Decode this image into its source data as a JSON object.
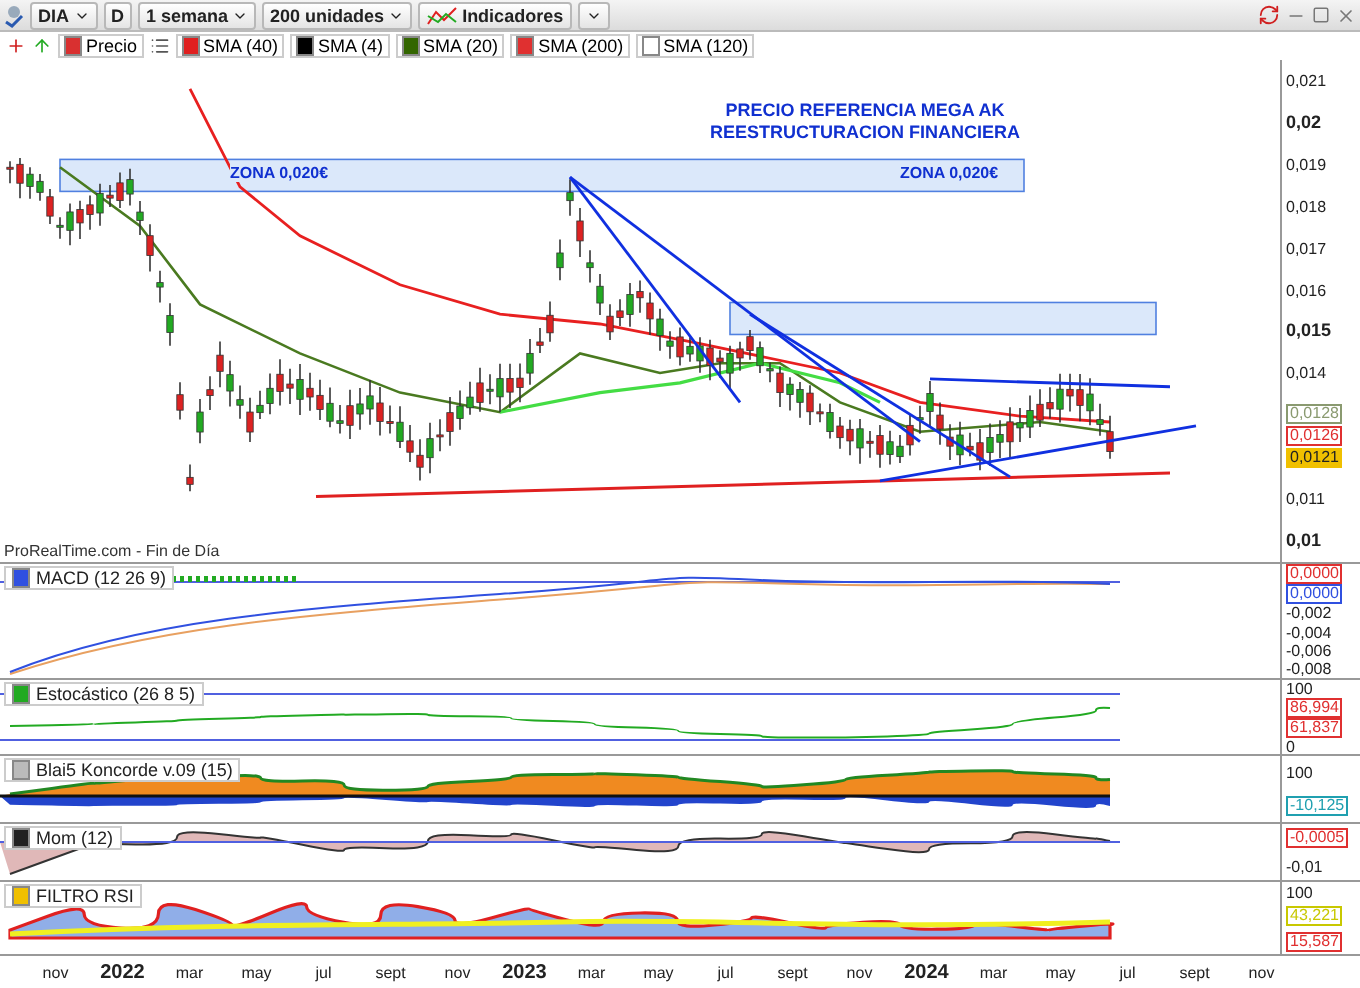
{
  "toolbar": {
    "symbol": "DIA",
    "interval": "D",
    "period": "1 semana",
    "units": "200 unidades",
    "indicators": "Indicadores"
  },
  "legend": {
    "items": [
      {
        "label": "Precio",
        "color": "#d93030"
      },
      {
        "label": "SMA (40)",
        "color": "#e02020"
      },
      {
        "label": "SMA (4)",
        "color": "#000000"
      },
      {
        "label": "SMA (20)",
        "color": "#336600"
      },
      {
        "label": "SMA (200)",
        "color": "#e03030"
      },
      {
        "label": "SMA (120)",
        "color": "#ffffff"
      }
    ]
  },
  "main_chart": {
    "title_lines": [
      "PRECIO REFERENCIA MEGA AK",
      "REESTRUCTURACION FINANCIERA"
    ],
    "zone_labels": [
      "ZONA 0,020€",
      "ZONA 0,020€"
    ],
    "source": "ProRealTime.com - Fin de Día",
    "y_axis_upper": [
      {
        "text": "0,021",
        "kind": "minor"
      },
      {
        "text": "0,02",
        "kind": "major"
      },
      {
        "text": "0,019",
        "kind": "minor"
      },
      {
        "text": "0,018",
        "kind": "minor"
      },
      {
        "text": "0,017",
        "kind": "minor"
      },
      {
        "text": "0,016",
        "kind": "minor"
      },
      {
        "text": "0,015",
        "kind": "major"
      },
      {
        "text": "0,014",
        "kind": "minor"
      }
    ],
    "price_labels": [
      {
        "text": "0,0128",
        "color": "#8a9a70"
      },
      {
        "text": "0,0126",
        "color": "#e03030"
      },
      {
        "text": "0,0121",
        "color": "#f0c000"
      }
    ],
    "y_axis_lower": [
      {
        "text": "0,011",
        "kind": "minor"
      },
      {
        "text": "0,01",
        "kind": "major"
      }
    ]
  },
  "indicators": [
    {
      "kind": "macd",
      "title": "MACD (12 26 9)",
      "axis": [
        {
          "text": "0,0000",
          "kind": "value",
          "color": "#e03030"
        },
        {
          "text": "0,0000",
          "kind": "value",
          "color": "#3050e0"
        },
        {
          "text": "-0,002",
          "kind": "tick"
        },
        {
          "text": "-0,004",
          "kind": "tick"
        },
        {
          "text": "-0,006",
          "kind": "tick"
        },
        {
          "text": "-0,008",
          "kind": "tick"
        }
      ]
    },
    {
      "kind": "stochastic",
      "title": "Estocástico (26 8 5)",
      "axis": [
        {
          "text": "100",
          "kind": "tick"
        },
        {
          "text": "86,994",
          "kind": "value",
          "color": "#e03030"
        },
        {
          "text": "61,837",
          "kind": "value",
          "color": "#e03030"
        },
        {
          "text": "0",
          "kind": "tick"
        }
      ]
    },
    {
      "kind": "koncorde",
      "title": "Blai5 Koncorde v.09 (15)",
      "axis": [
        {
          "text": "100",
          "kind": "tick"
        },
        {
          "text": "-10,125",
          "kind": "value",
          "color": "#20a0b0"
        }
      ]
    },
    {
      "kind": "momentum",
      "title": "Mom (12)",
      "axis": [
        {
          "text": "-0,0005",
          "kind": "value",
          "color": "#e03030"
        },
        {
          "text": "-0,01",
          "kind": "tick"
        }
      ]
    },
    {
      "kind": "rsi",
      "title": "FILTRO RSI",
      "axis": [
        {
          "text": "100",
          "kind": "tick"
        },
        {
          "text": "43,221",
          "kind": "value",
          "color": "#c8c800"
        },
        {
          "text": "15,587",
          "kind": "value",
          "color": "#e03030"
        }
      ]
    }
  ],
  "x_axis": [
    {
      "text": "nov",
      "kind": "month"
    },
    {
      "text": "2022",
      "kind": "year"
    },
    {
      "text": "mar",
      "kind": "month"
    },
    {
      "text": "may",
      "kind": "month"
    },
    {
      "text": "jul",
      "kind": "month"
    },
    {
      "text": "sept",
      "kind": "month"
    },
    {
      "text": "nov",
      "kind": "month"
    },
    {
      "text": "2023",
      "kind": "year"
    },
    {
      "text": "mar",
      "kind": "month"
    },
    {
      "text": "may",
      "kind": "month"
    },
    {
      "text": "jul",
      "kind": "month"
    },
    {
      "text": "sept",
      "kind": "month"
    },
    {
      "text": "nov",
      "kind": "month"
    },
    {
      "text": "2024",
      "kind": "year"
    },
    {
      "text": "mar",
      "kind": "month"
    },
    {
      "text": "may",
      "kind": "month"
    },
    {
      "text": "jul",
      "kind": "month"
    },
    {
      "text": "sept",
      "kind": "month"
    },
    {
      "text": "nov",
      "kind": "month"
    }
  ]
}
